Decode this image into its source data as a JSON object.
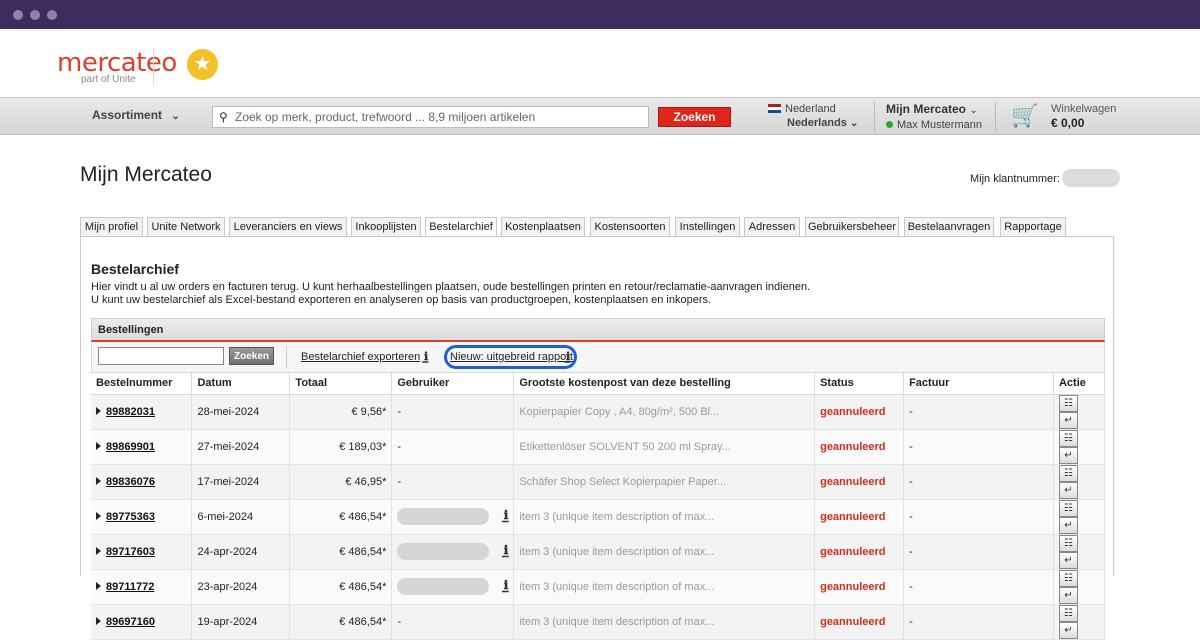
{
  "window": {
    "title": ""
  },
  "header": {
    "logo_text": "mercateo",
    "logo_sub": "part of Unite",
    "star_icon": "star-icon"
  },
  "nav": {
    "assortment_label": "Assortiment",
    "search_placeholder": "Zoek op merk, product, trefwoord ... 8,9 miljoen artikelen",
    "search_button": "Zoeken",
    "country": "Nederland",
    "language": "Nederlands",
    "account_title": "Mijn Mercateo",
    "account_user": "Max Mustermann",
    "cart_label": "Winkelwagen",
    "cart_total": "€ 0,00"
  },
  "page": {
    "title": "Mijn Mercateo",
    "customer_number_label": "Mijn klantnummer:"
  },
  "tabs": [
    "Mijn profiel",
    "Unite Network",
    "Leveranciers en views",
    "Inkooplijsten",
    "Bestelarchief",
    "Kostenplaatsen",
    "Kostensoorten",
    "Instellingen",
    "Adressen",
    "Gebruikersbeheer",
    "Bestelaanvragen",
    "Rapportage"
  ],
  "active_tab": "Bestelarchief",
  "archive": {
    "title": "Bestelarchief",
    "desc_line1": "Hier vindt u al uw orders en facturen terug. U kunt herhaalbestellingen plaatsen, oude bestellingen printen en retour/reclamatie-aanvragen indienen.",
    "desc_line2": "U kunt uw bestelarchief als Excel-bestand exporteren en analyseren op basis van productgroepen, kostenplaatsen en inkopers.",
    "section_title": "Bestellingen",
    "search_button": "Zoeken",
    "export_link": "Bestelarchief exporteren",
    "report_link": "Nieuw: uitgebreid rapport"
  },
  "columns": [
    "Bestelnummer",
    "Datum",
    "Totaal",
    "Gebruiker",
    "Grootste kostenpost van deze bestelling",
    "Status",
    "Factuur",
    "Actie"
  ],
  "orders": [
    {
      "number": "89882031",
      "date": "28-mei-2024",
      "total": "€ 9,56*",
      "user": "-",
      "user_hidden": false,
      "item": "Kopierpapier Copy , A4, 80g/m², 500 Bl...",
      "status": "geannuleerd",
      "invoice": "-"
    },
    {
      "number": "89869901",
      "date": "27-mei-2024",
      "total": "€ 189,03*",
      "user": "-",
      "user_hidden": false,
      "item": "Etikettenlöser SOLVENT 50 200 ml Spray...",
      "status": "geannuleerd",
      "invoice": "-"
    },
    {
      "number": "89836076",
      "date": "17-mei-2024",
      "total": "€ 46,95*",
      "user": "-",
      "user_hidden": false,
      "item": "Schäfer Shop Select Kopierpapier Paper...",
      "status": "geannuleerd",
      "invoice": "-"
    },
    {
      "number": "89775363",
      "date": "6-mei-2024",
      "total": "€ 486,54*",
      "user": "",
      "user_hidden": true,
      "item": "item 3 (unique item description of max...",
      "status": "geannuleerd",
      "invoice": "-"
    },
    {
      "number": "89717603",
      "date": "24-apr-2024",
      "total": "€ 486,54*",
      "user": "",
      "user_hidden": true,
      "item": "item 3 (unique item description of max...",
      "status": "geannuleerd",
      "invoice": "-"
    },
    {
      "number": "89711772",
      "date": "23-apr-2024",
      "total": "€ 486,54*",
      "user": "",
      "user_hidden": true,
      "item": "item 3 (unique item description of max...",
      "status": "geannuleerd",
      "invoice": "-"
    },
    {
      "number": "89697160",
      "date": "19-apr-2024",
      "total": "€ 486,54*",
      "user": "-",
      "user_hidden": false,
      "item": "item 3 (unique item description of max...",
      "status": "geannuleerd",
      "invoice": "-"
    }
  ],
  "colors": {
    "brand": "#d9412d",
    "titlebar": "#3d2c5e",
    "highlight": "#1e5fd6",
    "cancel": "#d42d1c"
  }
}
